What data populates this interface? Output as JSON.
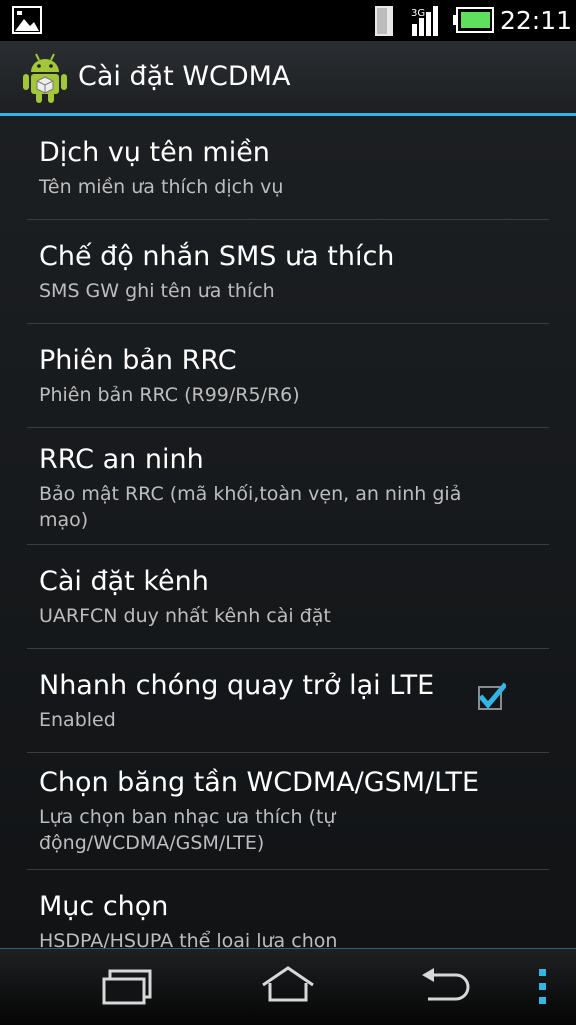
{
  "status_bar": {
    "time": "22:11"
  },
  "action_bar": {
    "title": "Cài đặt WCDMA"
  },
  "preferences": [
    {
      "title": "Dịch vụ tên miền",
      "summary": "Tên miền ưa thích dịch vụ"
    },
    {
      "title": "Chế độ nhắn SMS ưa thích",
      "summary": "SMS GW ghi tên ưa thích"
    },
    {
      "title": "Phiên bản RRC",
      "summary": "Phiên bản RRC (R99/R5/R6)"
    },
    {
      "title": "RRC an ninh",
      "summary": "Bảo mật RRC (mã khối,toàn vẹn, an ninh giả mạo)"
    },
    {
      "title": "Cài đặt kênh",
      "summary": "UARFCN duy nhất kênh cài đặt"
    },
    {
      "title": "Nhanh chóng quay trở lại LTE",
      "summary": "Enabled",
      "checked": true
    },
    {
      "title": "Chọn băng tần WCDMA/GSM/LTE",
      "summary": "Lựa chọn ban nhạc ưa thích (tự động/WCDMA/GSM/LTE)"
    },
    {
      "title": "Mục chọn",
      "summary": "HSDPA/HSUPA thể loại lựa chọn"
    }
  ],
  "icons": {
    "status": [
      "gallery-icon",
      "signal-strength-icon",
      "data-bars-icon",
      "battery-icon"
    ],
    "app": "android-icon",
    "nav": [
      "recent-apps-icon",
      "home-icon",
      "back-icon",
      "overflow-menu-icon"
    ]
  },
  "colors": {
    "accent": "#33b5e5",
    "background": "#1c1f22",
    "summary_text": "#bdbdbd"
  }
}
